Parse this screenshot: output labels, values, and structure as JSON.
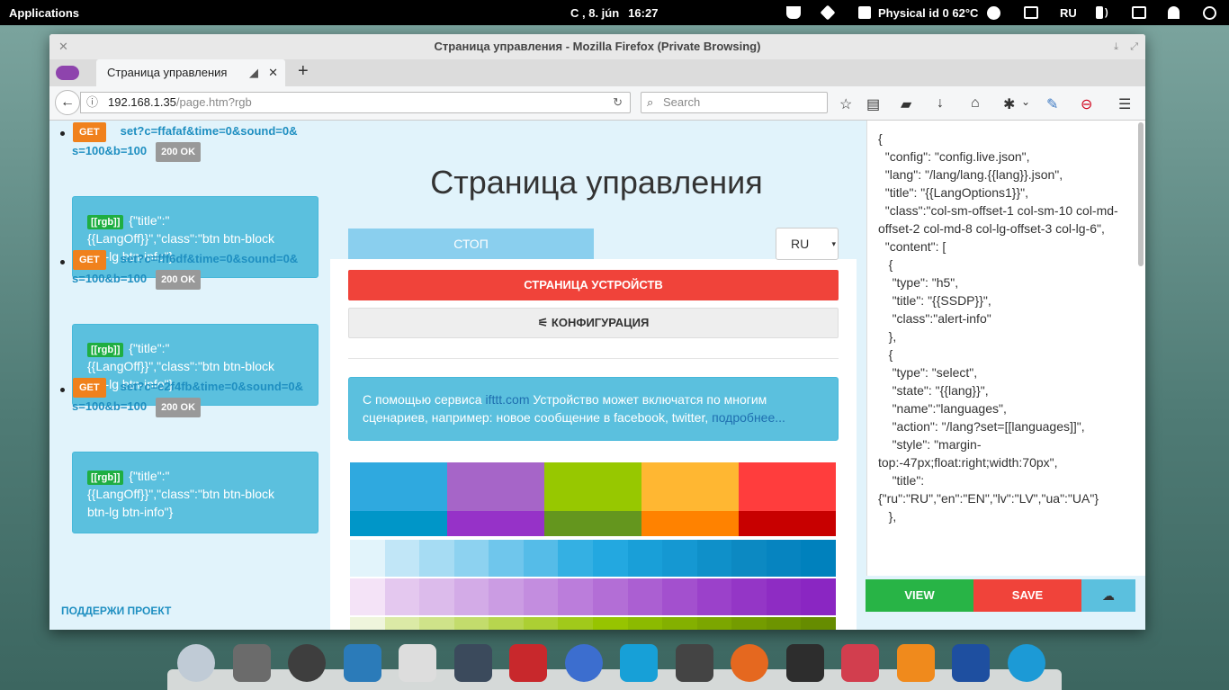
{
  "panel": {
    "apps": "Applications",
    "date": "С , 8. jún",
    "time": "16:27",
    "temp": "Physical id 0 62°C",
    "lang": "RU"
  },
  "window": {
    "title": "Страница управления - Mozilla Firefox (Private Browsing)",
    "tab_title": "Страница управления",
    "url_host": "192.168.1.35",
    "url_path": "/page.htm?rgb",
    "search_placeholder": "Search"
  },
  "log": [
    {
      "method": "GET",
      "query1": "set?c=ffafaf&time=0&sound=0&",
      "query2": "s=100&b=100",
      "status": "200 OK",
      "tag": "[[rgb]]",
      "line1": "{\"title\":\"",
      "line2": "{{LangOff}}\",\"class\":\"btn btn-block",
      "line3": "btn-lg btn-info\"}"
    },
    {
      "method": "GET",
      "query1": "set?c=fff6df&time=0&sound=0&",
      "query2": "s=100&b=100",
      "status": "200 OK",
      "tag": "[[rgb]]",
      "line1": "{\"title\":\"",
      "line2": "{{LangOff}}\",\"class\":\"btn btn-block",
      "line3": "btn-lg btn-info\"}"
    },
    {
      "method": "GET",
      "query1": "set?c=e2f4fb&time=0&sound=0&",
      "query2": "s=100&b=100",
      "status": "200 OK",
      "tag": "[[rgb]]",
      "line1": "{\"title\":\"",
      "line2": "{{LangOff}}\",\"class\":\"btn btn-block",
      "line3": "btn-lg btn-info\"}"
    }
  ],
  "support": "ПОДДЕРЖИ ПРОЕКТ",
  "main": {
    "title": "Страница управления",
    "stop": "СТОП",
    "lang_select": "RU",
    "devices_btn": "СТРАНИЦА УСТРОЙСТВ",
    "config_btn": "КОНФИГУРАЦИЯ",
    "info_a": "С помощью сервиса ",
    "info_link": "ifttt.com",
    "info_b": " Устройство может включатся по многим сценариев, например: новое сообщение в facebook, twitter, ",
    "info_more": "подробнее..."
  },
  "palette": {
    "top": [
      "#2fa9df",
      "#a665c8",
      "#97c800",
      "#ffb732",
      "#ff3d3d"
    ],
    "dark": [
      "#0096c8",
      "#9632c8",
      "#64961e",
      "#ff8200",
      "#c80000"
    ],
    "blues": [
      "#e2f4fb",
      "#c1e6f7",
      "#a6dcf3",
      "#8dd2f0",
      "#6fc6ec",
      "#55bce8",
      "#34b0e3",
      "#23a8e0",
      "#199fd8",
      "#1598d2",
      "#0f90c9",
      "#0c89c2",
      "#0684c0",
      "#0081bd"
    ],
    "purples": [
      "#f4e3f7",
      "#e4c8ef",
      "#dcbbeb",
      "#d3abe7",
      "#cb9ce3",
      "#c38ddf",
      "#bb7ddb",
      "#b36ed6",
      "#ab5fd2",
      "#a350ce",
      "#9b41ca",
      "#9436c6",
      "#8e2cc3",
      "#8a26c2"
    ],
    "greens": [
      "#eff5dc",
      "#dbeaa6",
      "#cfe389",
      "#c3dc6c",
      "#b7d54e",
      "#accf33",
      "#a1c91a",
      "#97c400",
      "#8cba00",
      "#84b000",
      "#7ca600",
      "#749c00",
      "#6d9400",
      "#668c00"
    ]
  },
  "editor": {
    "text": "{\n  \"config\": \"config.live.json\",\n  \"lang\": \"/lang/lang.{{lang}}.json\",\n  \"title\": \"{{LangOptions1}}\",\n  \"class\":\"col-sm-offset-1 col-sm-10 col-md-offset-2 col-md-8 col-lg-offset-3 col-lg-6\",\n  \"content\": [\n   {\n    \"type\": \"h5\",\n    \"title\": \"{{SSDP}}\",\n    \"class\":\"alert-info\"\n   },\n   {\n    \"type\": \"select\",\n    \"state\": \"{{lang}}\",\n    \"name\":\"languages\",\n    \"action\": \"/lang?set=[[languages]]\",\n    \"style\": \"margin-top:-47px;float:right;width:70px\",\n    \"title\": {\"ru\":\"RU\",\"en\":\"EN\",\"lv\":\"LV\",\"ua\":\"UA\"}\n   },",
    "view": "VIEW",
    "save": "SAVE"
  },
  "dock_icons": [
    "chromium",
    "files",
    "atom",
    "brackets",
    "text-editor",
    "settings",
    "filezilla",
    "keys",
    "kodi",
    "calculator",
    "firefox",
    "terminal",
    "mixer",
    "vlc",
    "iv",
    "skype"
  ],
  "dock_colors": [
    "#c0cbd6",
    "#6b6b6b",
    "#3e3e3e",
    "#2b7bb9",
    "#dddddd",
    "#3b4a5c",
    "#c8282c",
    "#3c6ecf",
    "#17a0d7",
    "#444444",
    "#e5681f",
    "#2d2d2d",
    "#d23e4e",
    "#f08a1c",
    "#1e4fa0",
    "#1c9ad6"
  ]
}
